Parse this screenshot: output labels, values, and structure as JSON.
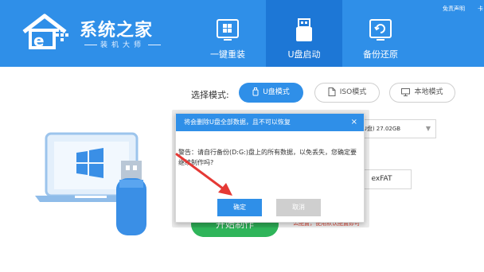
{
  "header": {
    "logo": {
      "title": "系统之家",
      "subtitle": "装机大师"
    },
    "nav": [
      {
        "label": "一键重装",
        "icon": "windows-install-icon",
        "active": false
      },
      {
        "label": "U盘启动",
        "icon": "usb-drive-icon",
        "active": true
      },
      {
        "label": "备份还原",
        "icon": "backup-restore-icon",
        "active": false
      }
    ],
    "top_links": {
      "disclaimer": "免责声明",
      "extra": "卡"
    }
  },
  "mode_selector": {
    "label": "选择模式:",
    "options": [
      {
        "label": "U盘模式",
        "icon": "usb-icon",
        "selected": true
      },
      {
        "label": "ISO模式",
        "icon": "file-icon",
        "selected": false
      },
      {
        "label": "本地模式",
        "icon": "monitor-icon",
        "selected": false
      }
    ]
  },
  "device_select": {
    "value": "(U盘) 27.02GB"
  },
  "format": {
    "filesystem": "exFAT"
  },
  "start_button": {
    "label": "开始制作"
  },
  "hint": {
    "text": "么配置，使用默认配置即可"
  },
  "dialog": {
    "title": "将会删除U盘全部数据，且不可以恢复",
    "close": "×",
    "message": "警告：请自行备份(D:G:)盘上的所有数据，以免丢失，您确定要继续制作吗?",
    "ok_label": "确定",
    "cancel_label": "取消"
  },
  "colors": {
    "header_bg": "#2f8fe8",
    "nav_active_bg": "#1d77d6",
    "accent": "#2f8fe8",
    "start_button": "#2fb55a",
    "hint_text": "#e74c3c",
    "arrow": "#e53935"
  }
}
